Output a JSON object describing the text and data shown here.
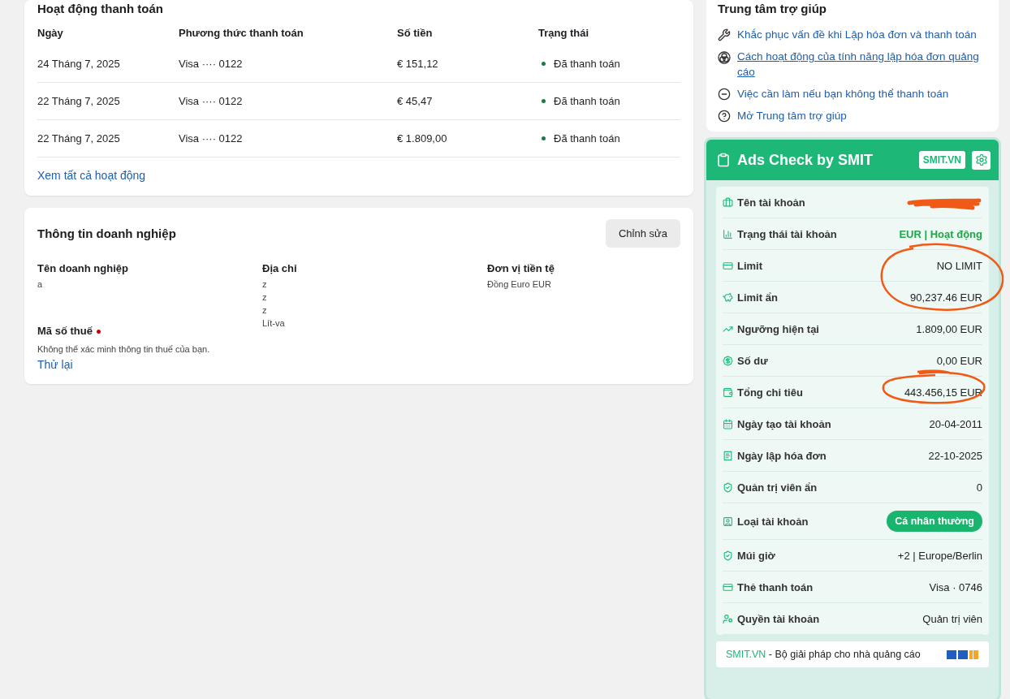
{
  "payments": {
    "title": "Hoạt động thanh toán",
    "columns": [
      "Ngày",
      "Phương thức thanh toán",
      "Số tiền",
      "Trạng thái"
    ],
    "rows": [
      {
        "date": "24 Tháng 7, 2025",
        "method": "Visa ···· 0122",
        "amount": "€ 151,12",
        "status": "Đã thanh toán",
        "color": "#1b7a4a"
      },
      {
        "date": "22 Tháng 7, 2025",
        "method": "Visa ···· 0122",
        "amount": "€ 45,47",
        "status": "Đã thanh toán",
        "color": "#1b7a4a"
      },
      {
        "date": "22 Tháng 7, 2025",
        "method": "Visa ···· 0122",
        "amount": "€ 1.809,00",
        "status": "Đã thanh toán",
        "color": "#1b7a4a"
      }
    ],
    "link": "Xem tất cả hoạt động"
  },
  "business": {
    "title": "Thông tin doanh nghiệp",
    "edit": "Chỉnh sửa",
    "fields": [
      {
        "label": "Tên doanh nghiệp",
        "lines": [
          "a"
        ]
      },
      {
        "label": "Địa chỉ",
        "lines": [
          "z",
          "z",
          "z",
          "Lít-va"
        ]
      },
      {
        "label": "Đơn vị tiền tệ",
        "lines": [
          "Đồng Euro EUR"
        ]
      }
    ],
    "tax": {
      "label": "Mã số thuế",
      "warning": true,
      "message": "Không thể xác minh thông tin thuế của bạn.",
      "retry": "Thử lại"
    }
  },
  "help": {
    "title": "Trung tâm trợ giúp",
    "links": [
      {
        "text": "Khắc phục vấn đề khi Lập hóa đơn và thanh toán",
        "underlined": false
      },
      {
        "text": "Cách hoạt động của tính năng lập hóa đơn quảng cáo",
        "underlined": true
      },
      {
        "text": "Việc cần làm nếu bạn không thể thanh toán",
        "underlined": false
      },
      {
        "text": "Mở Trung tâm trợ giúp",
        "underlined": false
      }
    ]
  },
  "ads_check": {
    "title": "Ads Check by SMIT",
    "site_button": "SMIT.VN",
    "rows": [
      {
        "label": "Tên tài khoản",
        "kind": "redacted",
        "circled": false
      },
      {
        "label": "Trạng thái tài khoản",
        "kind": "status",
        "value": "EUR | Hoạt động",
        "circled": false
      },
      {
        "label": "Limit",
        "kind": "text",
        "value": "NO LIMIT",
        "circled": true
      },
      {
        "label": "Limit ẩn",
        "kind": "text",
        "value": "90,237.46 EUR",
        "circled": true
      },
      {
        "label": "Ngưỡng hiện tại",
        "kind": "text",
        "value": "1.809,00 EUR",
        "circled": false
      },
      {
        "label": "Số dư",
        "kind": "text",
        "value": "0,00 EUR",
        "circled": false
      },
      {
        "label": "Tổng chi tiêu",
        "kind": "text",
        "value": "443.456,15 EUR",
        "circled": true
      },
      {
        "label": "Ngày tạo tài khoản",
        "kind": "text",
        "value": "20-04-2011",
        "circled": false
      },
      {
        "label": "Ngày lập hóa đơn",
        "kind": "text",
        "value": "22-10-2025",
        "circled": false
      },
      {
        "label": "Quản trị viên ẩn",
        "kind": "text",
        "value": "0",
        "circled": false
      },
      {
        "label": "Loại tài khoản",
        "kind": "badge",
        "value": "Cá nhân thường",
        "circled": false
      },
      {
        "label": "Múi giờ",
        "kind": "text",
        "value": "+2 | Europe/Berlin",
        "circled": false
      },
      {
        "label": "Thẻ thanh toán",
        "kind": "text",
        "value": "Visa · 0746",
        "circled": false
      },
      {
        "label": "Quyền tài khoản",
        "kind": "text",
        "value": "Quản trị viên",
        "circled": false
      }
    ],
    "footer": {
      "brand": "SMIT.VN",
      "tagline": " - Bộ giải pháp cho nhà quảng cáo"
    }
  }
}
